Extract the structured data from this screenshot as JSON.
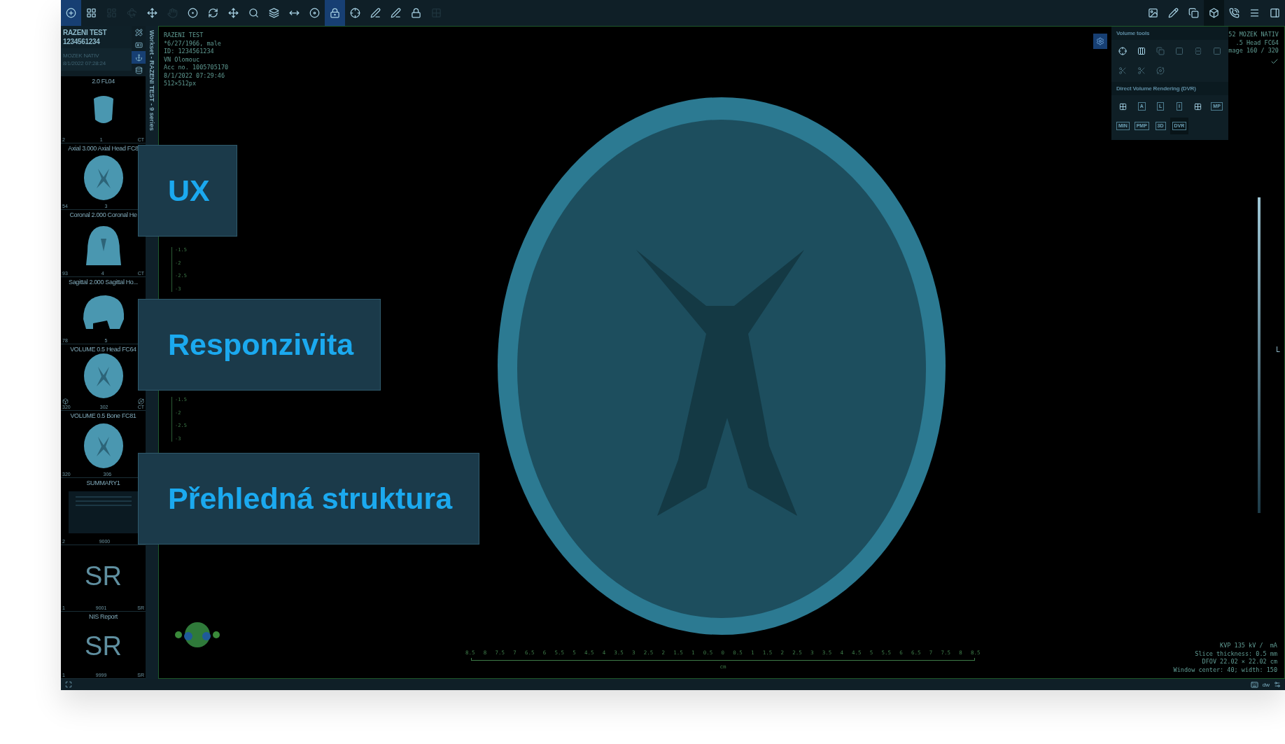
{
  "toolbar": {
    "left_tools": [
      {
        "selected": true,
        "disabled": false
      },
      {
        "selected": false,
        "disabled": false
      },
      {
        "selected": false,
        "disabled": true
      },
      {
        "selected": false,
        "disabled": true
      },
      {
        "selected": false,
        "disabled": false
      },
      {
        "selected": false,
        "disabled": true
      },
      {
        "selected": false,
        "disabled": false
      },
      {
        "selected": false,
        "disabled": false
      },
      {
        "selected": false,
        "disabled": false
      },
      {
        "selected": false,
        "disabled": false
      },
      {
        "selected": false,
        "disabled": false
      },
      {
        "selected": false,
        "disabled": false
      },
      {
        "selected": false,
        "disabled": false
      },
      {
        "selected": true,
        "disabled": false
      },
      {
        "selected": false,
        "disabled": false
      },
      {
        "selected": false,
        "disabled": false
      },
      {
        "selected": false,
        "disabled": false
      },
      {
        "selected": false,
        "disabled": false
      },
      {
        "selected": false,
        "disabled": true
      }
    ],
    "right_tools": [
      {
        "selected": false
      },
      {
        "selected": false
      },
      {
        "selected": false
      },
      {
        "selected": true
      },
      {
        "selected": false
      },
      {
        "selected": false
      },
      {
        "selected": false
      }
    ]
  },
  "sidebar": {
    "patient": {
      "name": "RAZENI TEST",
      "id": "1234561234"
    },
    "study": {
      "name": "MOZEK NATIV",
      "date": "8/1/2022 07:28:24"
    },
    "side_buttons": [
      {
        "selected": false
      },
      {
        "selected": false
      },
      {
        "selected": true
      },
      {
        "selected": false
      }
    ],
    "workset": "Workset - RAZENI TEST - 9 series",
    "series": [
      {
        "kind": "scout",
        "title": "2.0 FL04",
        "count": "2",
        "number": "1",
        "modality": "CT"
      },
      {
        "kind": "axial",
        "title": "Axial 3.000 Axial Head FC8",
        "count": "54",
        "number": "3"
      },
      {
        "kind": "coronal",
        "title": "Coronal 2.000 Coronal He",
        "count": "93",
        "number": "4",
        "modality": "CT"
      },
      {
        "kind": "sagittal",
        "title": "Sagittal 2.000 Sagittal Ho...",
        "count": "78",
        "number": "5"
      },
      {
        "kind": "volume",
        "title": "VOLUME 0.5 Head FC64",
        "count": "320",
        "number": "302",
        "modality": "CT"
      },
      {
        "kind": "axial",
        "title": "VOLUME 0.5 Bone FC81",
        "count": "320",
        "number": "306"
      },
      {
        "kind": "summary",
        "title": "SUMMARY1",
        "count": "2",
        "number": "9000"
      },
      {
        "kind": "sr",
        "big_label": "SR",
        "count": "1",
        "number": "9001",
        "modality": "SR"
      },
      {
        "kind": "sr",
        "title": "NIS Report",
        "big_label": "SR",
        "count": "1",
        "number": "9999",
        "modality": "SR"
      }
    ]
  },
  "viewport": {
    "patient_info": [
      "RAZENI TEST",
      "*6/27/1966, male",
      "ID: 1234561234",
      "VN Olomouc",
      "Acc no. 1005705170",
      "8/1/2022 07:29:46",
      "512×512px"
    ],
    "series_info": [
      "52 MOZEK NATIV",
      ".5 Head FC64",
      "mage 160 / 320"
    ],
    "scan_info": [
      "KVP 135 kV /  mA",
      "Slice thickness: 0.5 mm",
      "DFOV 22.02 × 22.02 cm",
      "Window center: 40; width: 150"
    ],
    "left_scale": [
      [
        "-1.5",
        "-2",
        "-2.5",
        "-3"
      ],
      [
        "-1.5",
        "-2",
        "-2.5",
        "-3"
      ]
    ],
    "ruler": {
      "labels": [
        "8.5",
        "8",
        "7.5",
        "7",
        "6.5",
        "6",
        "5.5",
        "5",
        "4.5",
        "4",
        "3.5",
        "3",
        "2.5",
        "2",
        "1.5",
        "1",
        "0.5",
        "0",
        "0.5",
        "1",
        "1.5",
        "2",
        "2.5",
        "3",
        "3.5",
        "4",
        "4.5",
        "5",
        "5.5",
        "6",
        "6.5",
        "7",
        "7.5",
        "8",
        "8.5"
      ],
      "unit": "cm"
    },
    "orientation": "L",
    "volume_panel": {
      "title": "Volume tools",
      "tools": [
        {
          "disabled": false
        },
        {
          "disabled": false
        },
        {
          "disabled": true
        },
        {
          "disabled": true
        },
        {
          "disabled": true
        },
        {
          "disabled": true
        },
        {
          "disabled": true
        },
        {
          "disabled": true
        },
        {
          "disabled": true
        }
      ],
      "dvr_title": "Direct Volume Rendering (DVR)",
      "modes": [
        {
          "kind": "icon",
          "selected": false
        },
        {
          "kind": "text",
          "label": "A",
          "selected": false
        },
        {
          "kind": "text",
          "label": "L",
          "selected": false
        },
        {
          "kind": "text",
          "label": "I",
          "selected": false
        },
        {
          "kind": "icon",
          "selected": false
        },
        {
          "kind": "text",
          "label": "MP",
          "selected": false
        },
        {
          "kind": "text",
          "label": "MIN",
          "selected": false
        },
        {
          "kind": "text",
          "label": "PMP",
          "selected": false
        },
        {
          "kind": "text",
          "label": "3D",
          "selected": false
        },
        {
          "kind": "text",
          "label": "DVR",
          "selected": true
        }
      ]
    }
  },
  "callouts": [
    "UX",
    "Responzivita",
    "Přehledná struktura"
  ],
  "status_bar": {
    "keyboard_layout": "dw"
  }
}
